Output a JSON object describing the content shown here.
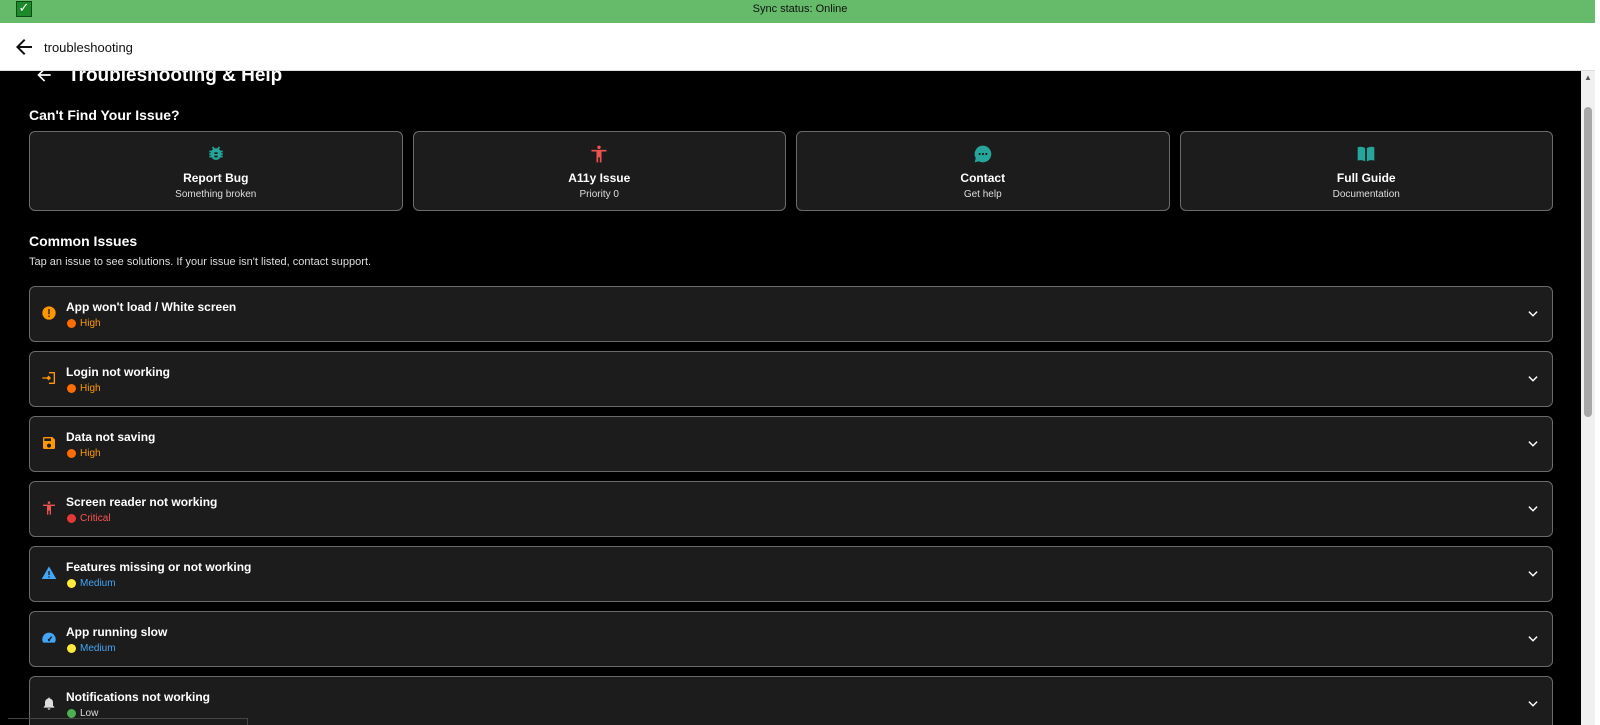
{
  "status_bar": {
    "check_icon": "check-box-icon",
    "text": "Sync status: Online",
    "color": "#66bb6a"
  },
  "app_bar": {
    "back_icon": "arrow-left-icon",
    "search_text": "troubleshooting"
  },
  "page": {
    "back_icon": "arrow-left-icon",
    "title": "Troubleshooting & Help"
  },
  "quick_actions": {
    "heading": "Can't Find Your Issue?",
    "cards": [
      {
        "icon": "bug-icon",
        "title": "Report Bug",
        "subtitle": "Something broken",
        "color": "#26a69a"
      },
      {
        "icon": "accessibility-icon",
        "title": "A11y Issue",
        "subtitle": "Priority 0",
        "color": "#ef5350"
      },
      {
        "icon": "chat-icon",
        "title": "Contact",
        "subtitle": "Get help",
        "color": "#26a69a"
      },
      {
        "icon": "book-icon",
        "title": "Full Guide",
        "subtitle": "Documentation",
        "color": "#26a69a"
      }
    ]
  },
  "common_issues": {
    "heading": "Common Issues",
    "description": "Tap an issue to see solutions. If your issue isn't listed, contact support.",
    "items": [
      {
        "icon": "warning-circle-icon",
        "icon_color": "#ff9800",
        "title": "App won't load / White screen",
        "severity": "High",
        "dot_color": "#ff6d00",
        "text_color": "#ff9800"
      },
      {
        "icon": "login-icon",
        "icon_color": "#ff9800",
        "title": "Login not working",
        "severity": "High",
        "dot_color": "#ff6d00",
        "text_color": "#ff9800"
      },
      {
        "icon": "save-icon",
        "icon_color": "#ff9800",
        "title": "Data not saving",
        "severity": "High",
        "dot_color": "#ff6d00",
        "text_color": "#ff9800"
      },
      {
        "icon": "accessibility-icon",
        "icon_color": "#ef5350",
        "title": "Screen reader not working",
        "severity": "Critical",
        "dot_color": "#e53935",
        "text_color": "#ff5252"
      },
      {
        "icon": "warning-triangle-icon",
        "icon_color": "#42a5f5",
        "title": "Features missing or not working",
        "severity": "Medium",
        "dot_color": "#ffeb3b",
        "text_color": "#42a5f5"
      },
      {
        "icon": "speed-icon",
        "icon_color": "#42a5f5",
        "title": "App running slow",
        "severity": "Medium",
        "dot_color": "#ffeb3b",
        "text_color": "#42a5f5"
      },
      {
        "icon": "bell-icon",
        "icon_color": "#dddddd",
        "title": "Notifications not working",
        "severity": "Low",
        "dot_color": "#4caf50",
        "text_color": "#dddddd"
      }
    ]
  }
}
